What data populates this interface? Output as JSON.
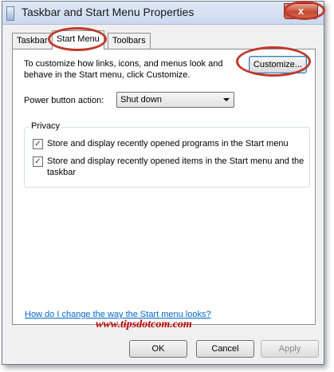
{
  "window": {
    "title": "Taskbar and Start Menu Properties",
    "close_glyph": "x"
  },
  "tabs": [
    {
      "label": "Taskbar",
      "active": false
    },
    {
      "label": "Start Menu",
      "active": true
    },
    {
      "label": "Toolbars",
      "active": false
    }
  ],
  "start_menu": {
    "intro_text": "To customize how links, icons, and menus look and behave in the Start menu, click Customize.",
    "customize_label": "Customize...",
    "power_label": "Power button action:",
    "power_value": "Shut down",
    "privacy": {
      "title": "Privacy",
      "items": [
        {
          "label": "Store and display recently opened programs in the Start menu",
          "checked": true
        },
        {
          "label": "Store and display recently opened items in the Start menu and the taskbar",
          "checked": true
        }
      ]
    },
    "help_link": "How do I change the way the Start menu looks?"
  },
  "watermark": "www.tipsdotcom.com",
  "footer": {
    "ok_label": "OK",
    "cancel_label": "Cancel",
    "apply_label": "Apply"
  },
  "colors": {
    "highlight_oval": "#c0392b",
    "link": "#0066cc",
    "watermark": "#c00000"
  }
}
